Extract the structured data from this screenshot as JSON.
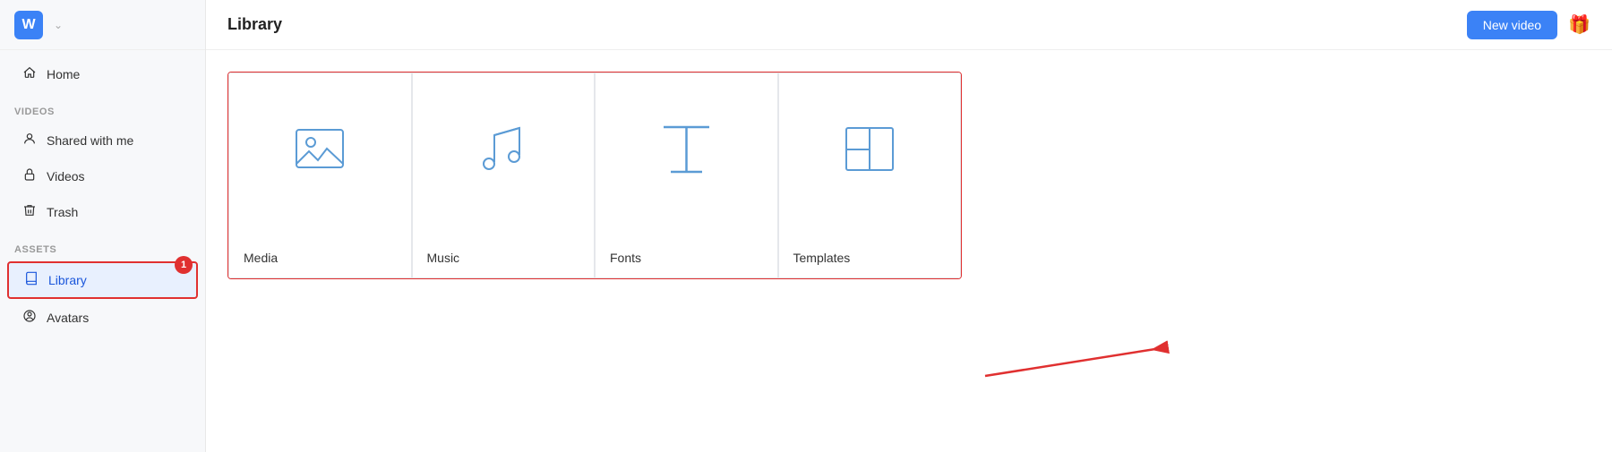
{
  "sidebar": {
    "logo_letter": "W",
    "sections": [
      {
        "label": "Videos",
        "items": [
          {
            "id": "shared-with-me",
            "label": "Shared with me",
            "icon": "person",
            "active": false
          },
          {
            "id": "videos",
            "label": "Videos",
            "icon": "lock",
            "active": false
          },
          {
            "id": "trash",
            "label": "Trash",
            "icon": "trash",
            "active": false
          }
        ]
      },
      {
        "label": "Assets",
        "items": [
          {
            "id": "library",
            "label": "Library",
            "icon": "book",
            "active": true,
            "badge": "1"
          },
          {
            "id": "avatars",
            "label": "Avatars",
            "icon": "person-circle",
            "active": false
          }
        ]
      }
    ],
    "home": {
      "label": "Home",
      "icon": "home"
    }
  },
  "header": {
    "title": "Library",
    "new_video_label": "New video"
  },
  "cards": [
    {
      "id": "media",
      "label": "Media"
    },
    {
      "id": "music",
      "label": "Music"
    },
    {
      "id": "fonts",
      "label": "Fonts"
    },
    {
      "id": "templates",
      "label": "Templates"
    }
  ]
}
